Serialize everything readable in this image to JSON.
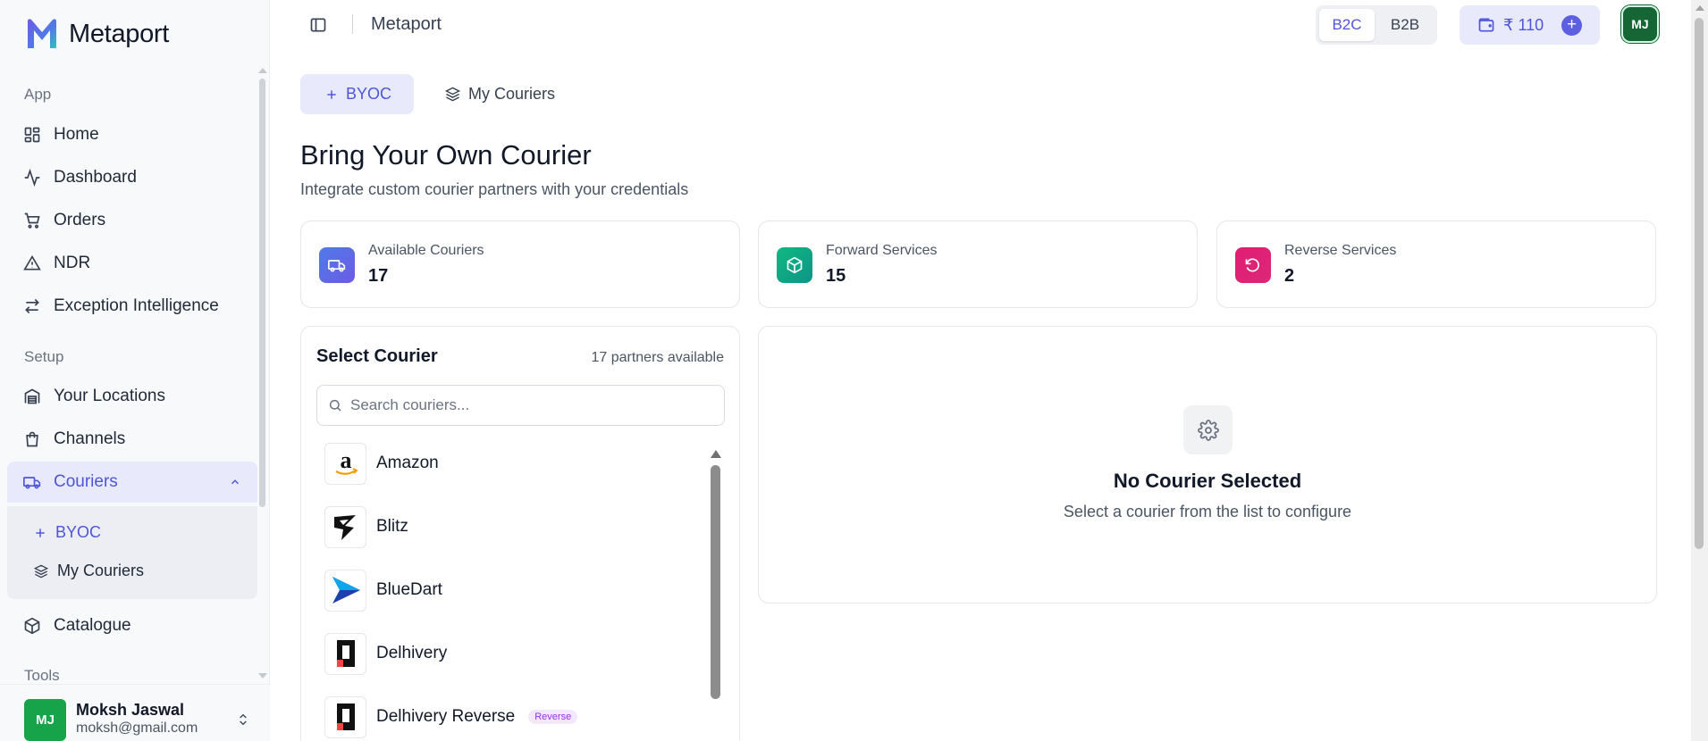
{
  "app": {
    "name": "Metaport"
  },
  "sidebar": {
    "sections": {
      "app": "App",
      "setup": "Setup",
      "tools": "Tools"
    },
    "items": [
      {
        "label": "Home",
        "icon": "grid-icon"
      },
      {
        "label": "Dashboard",
        "icon": "activity-icon"
      },
      {
        "label": "Orders",
        "icon": "cart-icon"
      },
      {
        "label": "NDR",
        "icon": "alert-triangle-icon"
      },
      {
        "label": "Exception Intelligence",
        "icon": "arrows-icon"
      },
      {
        "label": "Your Locations",
        "icon": "warehouse-icon"
      },
      {
        "label": "Channels",
        "icon": "bag-icon"
      },
      {
        "label": "Couriers",
        "icon": "truck-icon"
      },
      {
        "label": "Catalogue",
        "icon": "package-icon"
      }
    ],
    "subitems": [
      {
        "label": "BYOC",
        "icon": "plus-icon"
      },
      {
        "label": "My Couriers",
        "icon": "layers-icon"
      }
    ],
    "user": {
      "initials": "MJ",
      "name": "Moksh Jaswal",
      "email": "moksh@gmail.com"
    }
  },
  "topbar": {
    "title": "Metaport",
    "mode_options": [
      "B2C",
      "B2B"
    ],
    "selected_mode": "B2C",
    "wallet_balance": "₹ 110",
    "avatar_initials": "MJ"
  },
  "tabs": [
    {
      "label": "BYOC",
      "icon": "plus-icon"
    },
    {
      "label": "My Couriers",
      "icon": "layers-icon"
    }
  ],
  "page": {
    "title": "Bring Your Own Courier",
    "subtitle": "Integrate custom courier partners with your credentials"
  },
  "stats": [
    {
      "label": "Available Couriers",
      "value": "17",
      "icon": "truck-icon",
      "color": "#5b5fe0"
    },
    {
      "label": "Forward Services",
      "value": "15",
      "icon": "package-icon",
      "color": "#10b981"
    },
    {
      "label": "Reverse Services",
      "value": "2",
      "icon": "rotate-ccw-icon",
      "color": "#e11d74"
    }
  ],
  "courier_list": {
    "title": "Select Courier",
    "count_label": "17 partners available",
    "search_placeholder": "Search couriers...",
    "items": [
      {
        "name": "Amazon",
        "badge": ""
      },
      {
        "name": "Blitz",
        "badge": ""
      },
      {
        "name": "BlueDart",
        "badge": ""
      },
      {
        "name": "Delhivery",
        "badge": ""
      },
      {
        "name": "Delhivery Reverse",
        "badge": "Reverse"
      }
    ]
  },
  "detail": {
    "title": "No Courier Selected",
    "subtitle": "Select a courier from the list to configure"
  },
  "colors": {
    "accent": "#5b5fe0",
    "accent_bg": "#e8eafb",
    "green": "#16a34a"
  }
}
